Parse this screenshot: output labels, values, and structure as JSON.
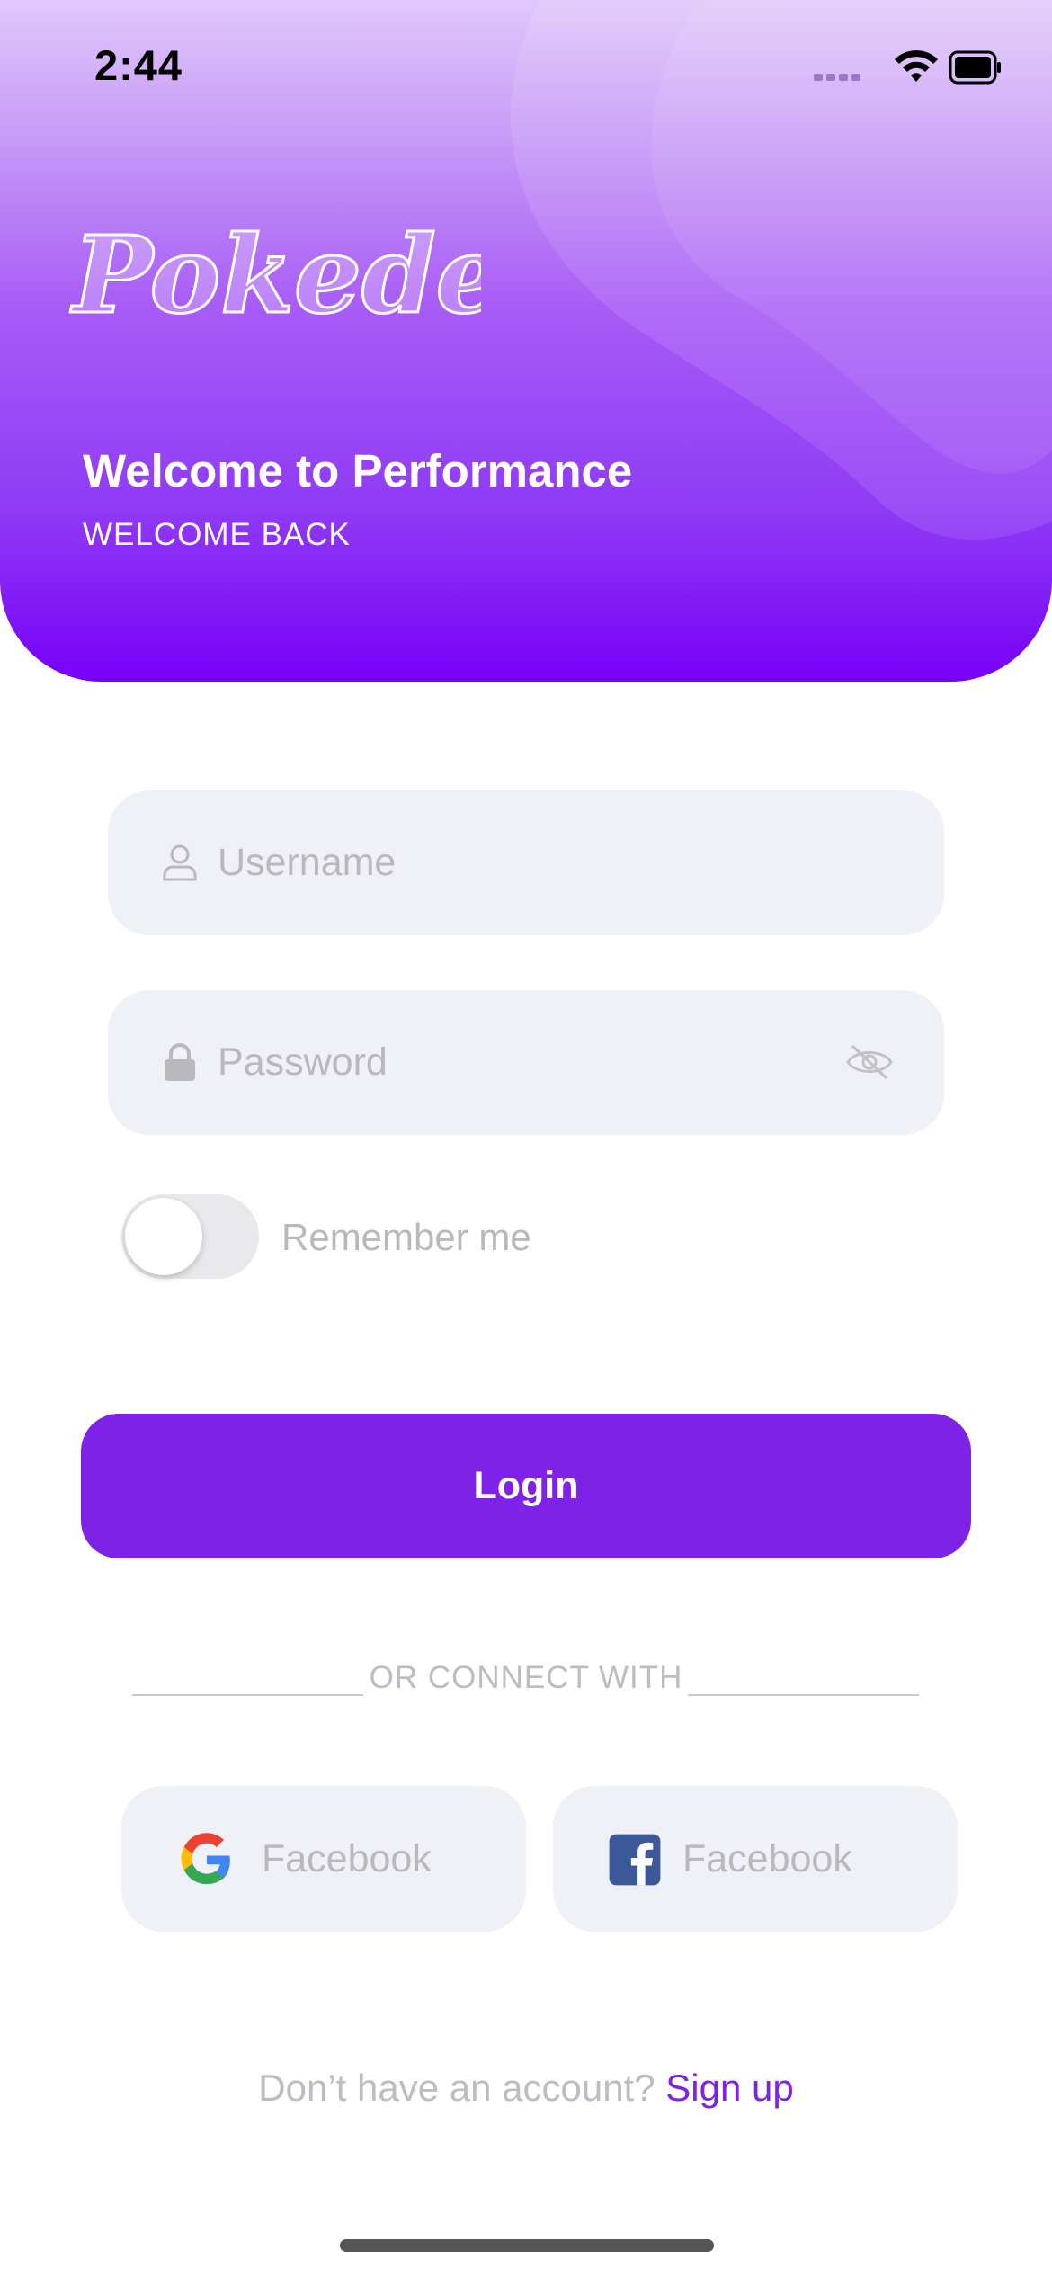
{
  "status_bar": {
    "time": "2:44"
  },
  "header": {
    "logo_text": "Pokedex",
    "title": "Welcome to Performance",
    "subtitle": "WELCOME BACK"
  },
  "form": {
    "username_placeholder": "Username",
    "password_placeholder": "Password",
    "remember_label": "Remember me",
    "remember_on": false,
    "login_label": "Login"
  },
  "divider": {
    "text": "OR CONNECT WITH"
  },
  "social": {
    "google_label": "Facebook",
    "facebook_label": "Facebook"
  },
  "footer": {
    "prompt": "Don’t have an account? ",
    "link": "Sign up"
  },
  "colors": {
    "accent": "#7e22e8",
    "header_top": "#e0c8fb",
    "header_bottom": "#7700f7",
    "field_bg": "#f0f1f6",
    "placeholder": "#b9b9bd"
  },
  "icons": [
    "wifi-icon",
    "battery-icon",
    "signal-icon",
    "user-icon",
    "lock-icon",
    "eye-off-icon",
    "google-icon",
    "facebook-icon"
  ]
}
